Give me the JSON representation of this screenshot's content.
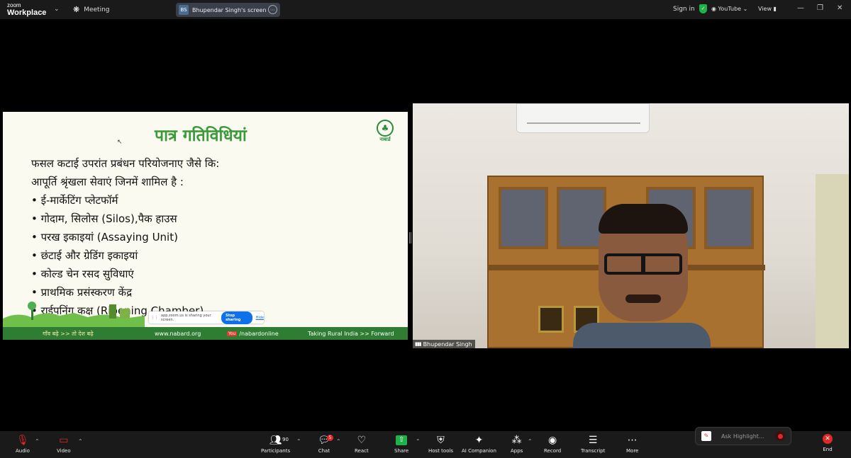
{
  "app": {
    "logo_line1": "zoom",
    "logo_line2": "Workplace",
    "meeting_label": "Meeting",
    "share_initials": "BS",
    "share_label": "Bhupendar Singh's screen",
    "signin": "Sign in",
    "youtube": "YouTube",
    "view": "View"
  },
  "slide": {
    "title": "पात्र गतिविधियां",
    "logo_name": "नाबार्ड",
    "lines": [
      "फसल कटाई उपरांत प्रबंधन परियोजनाए जैसे कि:",
      "आपूर्ति श्रृंखला सेवाएं जिनमें शामिल है :",
      "• ई-मार्केटिंग प्लेटफॉर्म",
      "• गोदाम, सिलोस (Silos),पैक हाउस",
      "• परख इकाइयां (Assaying Unit)",
      "• छंटाई और ग्रेडिंग इकाइयां",
      "• कोल्ड चेन रसद सुविधाएं",
      "• प्राथमिक प्रसंस्करण केंद्र",
      "• राईपनिंग कक्ष (Ripening Chamber)"
    ],
    "footer_tagline": "गाँव बढ़े >> तो देश बढ़े",
    "footer_web": "www.nabard.org",
    "footer_yt_badge": "You",
    "footer_yt": "/nabardonline",
    "footer_motto": "Taking Rural India >> Forward"
  },
  "sharing_bar": {
    "message": "app.zoom.us is sharing your screen.",
    "stop": "Stop sharing",
    "hide": "Hide"
  },
  "video": {
    "name": "Bhupendar Singh"
  },
  "toolbar": {
    "audio": "Audio",
    "video": "Video",
    "participants": "Participants",
    "participants_count": "90",
    "chat": "Chat",
    "chat_badge": "5",
    "react": "React",
    "share": "Share",
    "host_tools": "Host tools",
    "ai_companion": "AI Companion",
    "apps": "Apps",
    "record": "Record",
    "transcript": "Transcript",
    "more": "More",
    "ask_placeholder": "Ask Highlight...",
    "end": "End"
  }
}
